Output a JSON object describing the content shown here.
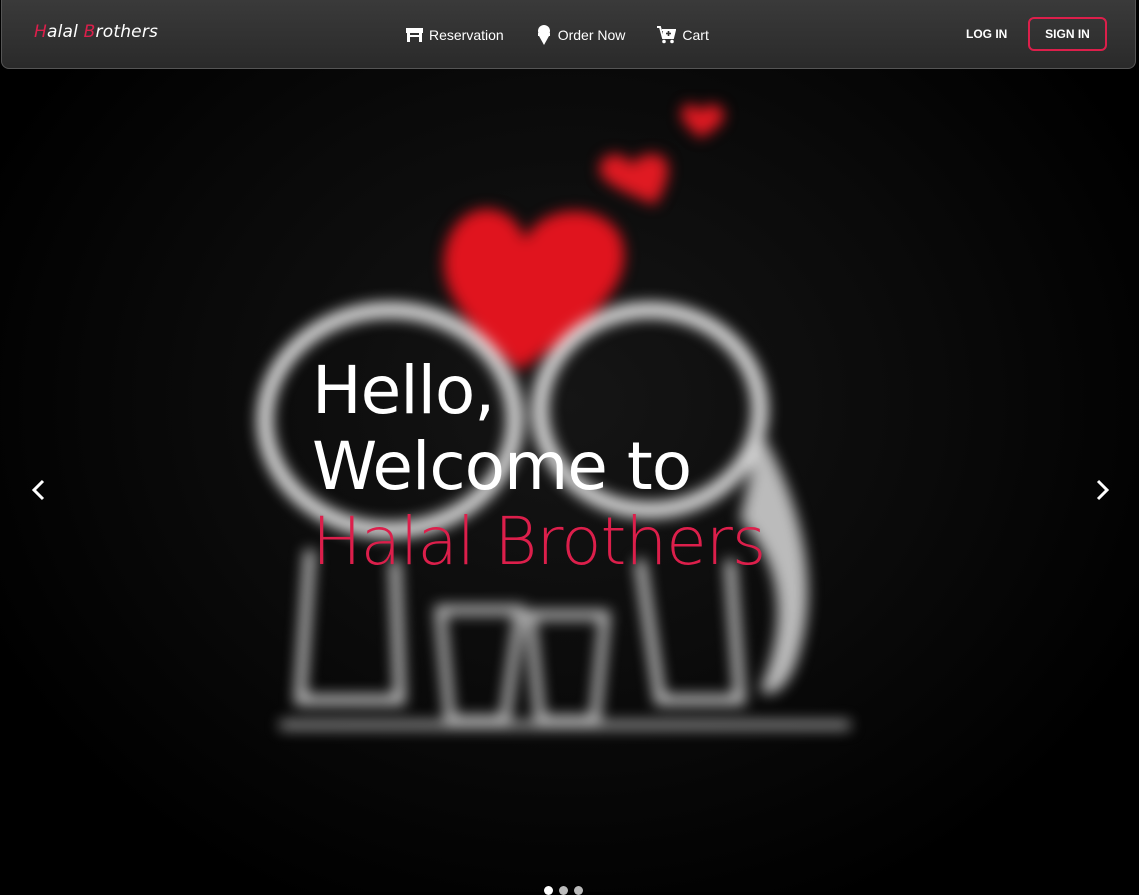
{
  "brand": {
    "first_initial": "H",
    "first_rest": "alal ",
    "second_initial": "B",
    "second_rest": "rothers"
  },
  "nav": {
    "reservation": "Reservation",
    "order_now": "Order Now",
    "cart": "Cart",
    "login": "LOG IN",
    "signin": "SIGN IN"
  },
  "hero": {
    "line1": "Hello,",
    "line2": "Welcome to",
    "line3": "Halal Brothers"
  },
  "carousel": {
    "slides": 3,
    "active_index": 0
  },
  "colors": {
    "accent": "#dc1f4b",
    "navbar": "#333333",
    "background": "#000000"
  },
  "icons": {
    "reservation": "table-icon",
    "order_now": "ice-cream-icon",
    "cart": "cart-plus-icon",
    "prev": "chevron-left-icon",
    "next": "chevron-right-icon"
  }
}
